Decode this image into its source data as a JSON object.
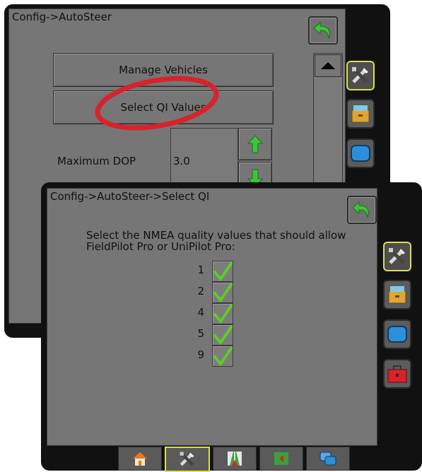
{
  "autosteer_screen": {
    "title": "Config->AutoSteer",
    "manage_vehicles_label": "Manage Vehicles",
    "select_qi_label": "Select QI Values",
    "max_dop_label": "Maximum DOP",
    "max_dop_value": "3.0"
  },
  "select_qi_screen": {
    "title": "Config->AutoSteer->Select QI",
    "prompt": "Select the NMEA quality values that should allow FieldPilot Pro or UniPilot Pro:",
    "qi_values": [
      {
        "value": "1",
        "checked": true
      },
      {
        "value": "2",
        "checked": true
      },
      {
        "value": "4",
        "checked": true
      },
      {
        "value": "5",
        "checked": true
      },
      {
        "value": "9",
        "checked": true
      }
    ]
  },
  "side_tabs": [
    "tools-icon",
    "filing-cabinet-icon",
    "display-icon",
    "toolbox-icon"
  ],
  "bottom_tabs": [
    "home-icon",
    "tools-icon",
    "guidance-icon",
    "map-icon",
    "windows-icon"
  ],
  "colors": {
    "panel_gray": "#767676",
    "active_highlight": "#d8e24a",
    "back_arrow_green": "#3ec43a",
    "check_green": "#5ecb2a",
    "annotation_red": "#d8232b"
  }
}
